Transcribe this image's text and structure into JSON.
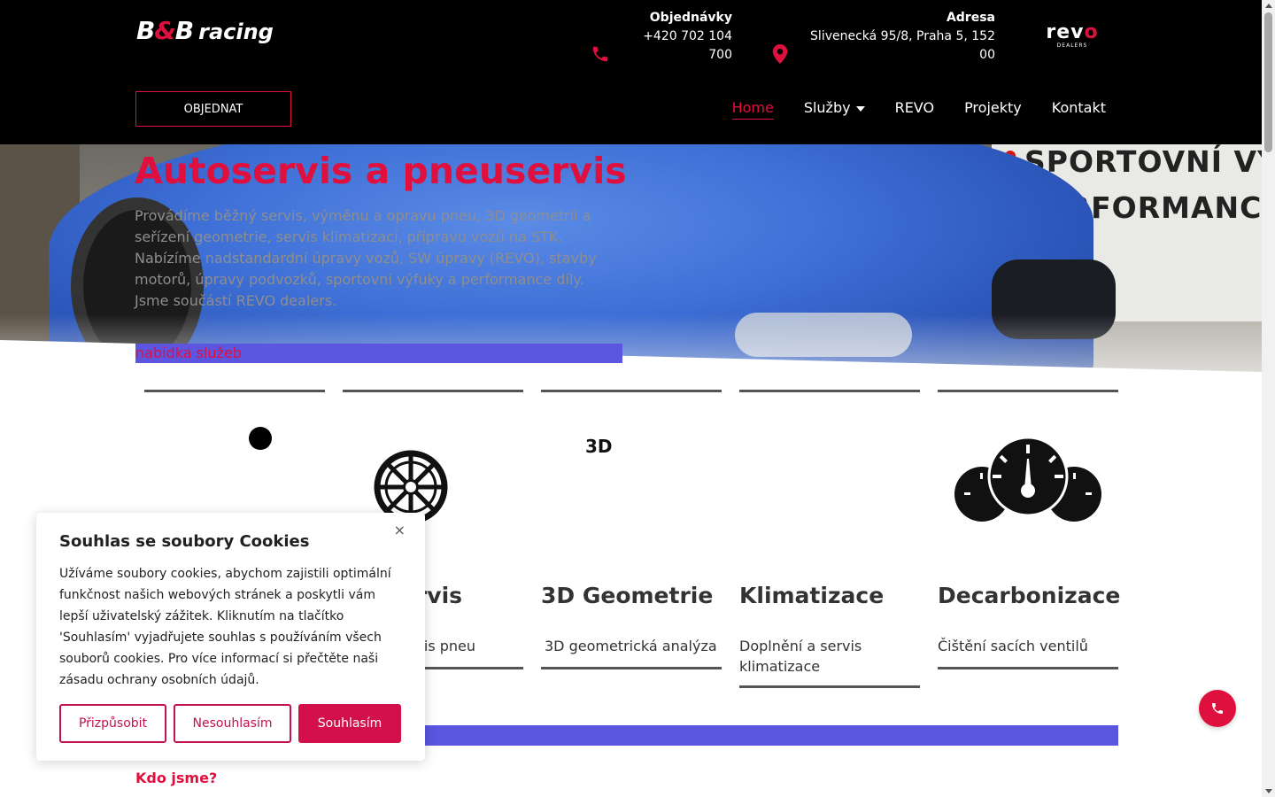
{
  "header": {
    "logo": {
      "text_main": "B",
      "text_amp": "&",
      "text_main2": "B",
      "text_rest": "racing"
    },
    "orders": {
      "title": "Objednávky",
      "value": "+420 702 104 700"
    },
    "address": {
      "title": "Adresa",
      "value": "Slivenecká 95/8, Praha 5, 152 00"
    },
    "revo": {
      "big_pre": "rev",
      "big_o": "o",
      "small": "DEALERS"
    },
    "order_button": "OBJEDNAT",
    "nav": [
      {
        "label": "Home"
      },
      {
        "label": "Služby"
      },
      {
        "label": "REVO"
      },
      {
        "label": "Projekty"
      },
      {
        "label": "Kontakt"
      }
    ]
  },
  "hero": {
    "sign_lines": [
      "SPORTOVNÍ VÝ",
      "PERFORMANC"
    ],
    "title": "Autoservis a pneuservis",
    "text": "Provádíme běžný servis, výměnu a opravu pneu, 3D geometrii a seřízení geometrie, servis klimatizací, přípravu vozů na STK. Nabízíme nadstandardní úpravy vozů, SW úpravy (REVO), stavby motorů, úpravy podvozků, sportovní výfuky a performance díly. Jsme součástí REVO dealers."
  },
  "services_label": "nabídka služeb",
  "services": [
    {
      "title": "",
      "desc": "",
      "icon": "dot-icon"
    },
    {
      "title": "ervis",
      "desc": "ervis pneu",
      "icon": "wheel-icon"
    },
    {
      "title": "3D Geometrie",
      "desc": "3D geometrická analýza",
      "icon": "3d-icon",
      "icon_text": "3D"
    },
    {
      "title": "Klimatizace",
      "desc": "Doplnění a servis klimatizace",
      "icon": "none"
    },
    {
      "title": "Decarbonizace",
      "desc": "Čištění sacích ventilů",
      "icon": "gauges-icon"
    }
  ],
  "who_we_are": "Kdo jsme?",
  "cookie": {
    "title": "Souhlas se soubory Cookies",
    "close": "×",
    "text": "Užíváme soubory cookies, abychom zajistili optimální funkčnost našich webových stránek a poskytli vám lepší uživatelský zážitek. Kliknutím na tlačítko 'Souhlasím' vyjadřujete souhlas s používáním všech souborů cookies. Pro více informací si přečtěte naši zásadu ochrany osobních údajů.",
    "buttons": {
      "customize": "Přizpůsobit",
      "reject": "Nesouhlasím",
      "accept": "Souhlasím"
    }
  },
  "colors": {
    "accent": "#e0103e",
    "band": "#5b55e0",
    "header_bg": "#000000"
  }
}
